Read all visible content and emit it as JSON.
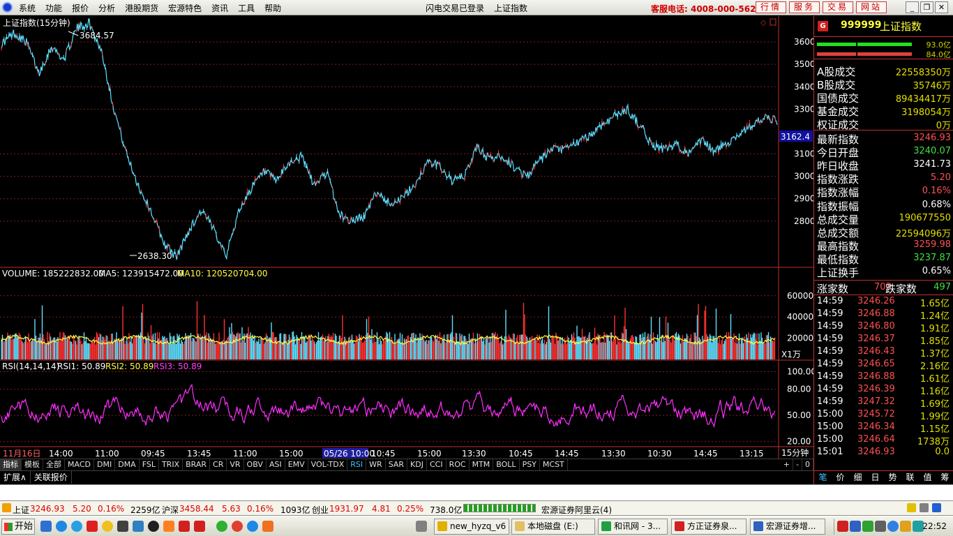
{
  "menubar": {
    "items": [
      "系统",
      "功能",
      "报价",
      "分析",
      "港股期货",
      "宏源特色",
      "资讯",
      "工具",
      "帮助"
    ],
    "status": "闪电交易已登录",
    "current": "上证指数",
    "phone": "客服电话: 4008-000-562",
    "buttons": [
      "行情",
      "服务",
      "交易",
      "网站"
    ]
  },
  "chart": {
    "title": "上证指数(15分钟)",
    "high_label": "3684.57",
    "low_label": "2638.30",
    "cursor_price": "3162.4",
    "price_ticks": [
      "3600",
      "3500",
      "3400",
      "3300",
      "3100",
      "3000",
      "2900",
      "2800"
    ],
    "volume_title": "VOLUME: 185222832.00",
    "ma5": "MA5: 123915472.00",
    "ma10": "MA10: 120520704.00",
    "volume_ticks": [
      "60000",
      "40000",
      "20000"
    ],
    "volume_unit": "X1万",
    "rsi_title": "RSI(14,14,14)",
    "rsi1": "RSI1: 50.89",
    "rsi2": "RSI2: 50.89",
    "rsi3": "RSI3: 50.89",
    "rsi_ticks": [
      "100.00",
      "80.00",
      "50.00",
      "20.00"
    ],
    "time_axis": [
      "11月16日",
      "14:00",
      "11:00",
      "09:45",
      "13:45",
      "11:00",
      "15:00",
      "05/26 10:00",
      "10:45",
      "15:00",
      "13:30",
      "10:45",
      "14:45",
      "13:30",
      "10:30",
      "14:45",
      "13:15"
    ],
    "period": "15分钟"
  },
  "chart_data": [
    {
      "type": "line",
      "title": "上证指数(15分钟)",
      "ylim": [
        2600,
        3700
      ],
      "y_ticks": [
        2800,
        2900,
        3000,
        3100,
        3300,
        3400,
        3500,
        3600
      ],
      "series": [
        {
          "values": [
            3590,
            3640,
            3600,
            3460,
            3580,
            3520,
            3660,
            3684.57,
            3560,
            3300,
            3100,
            2950,
            2840,
            2700,
            2638.3,
            2760,
            2850,
            2760,
            2650,
            2850,
            2950,
            3020,
            2980,
            3060,
            3090,
            2960,
            3020,
            2830,
            2800,
            2820,
            2930,
            2880,
            2900,
            2960,
            3060,
            3050,
            2980,
            3000,
            3130,
            3080,
            3090,
            3040,
            3000,
            3070,
            3120,
            3120,
            3150,
            3180,
            3230,
            3270,
            3300,
            3230,
            3140,
            3120,
            3140,
            3100,
            3160,
            3110,
            3150,
            3190,
            3230,
            3260,
            3246.93
          ]
        }
      ]
    },
    {
      "type": "bar",
      "title": "VOLUME: 185222832.00",
      "ylim": [
        0,
        75000
      ],
      "y_ticks": [
        20000,
        40000,
        60000
      ],
      "unit": "X1万"
    },
    {
      "type": "line",
      "title": "RSI(14,14,14)",
      "ylim": [
        15,
        110
      ],
      "y_ticks": [
        20,
        50,
        80,
        100
      ]
    }
  ],
  "quote": {
    "code": "999999",
    "name": "上证指数",
    "buy_val": "93.0亿",
    "sell_val": "84.0亿",
    "rows1": [
      {
        "k": "A股成交",
        "v": "22558350万",
        "c": "#e0e000"
      },
      {
        "k": "B股成交",
        "v": "35746万",
        "c": "#e0e000"
      },
      {
        "k": "国债成交",
        "v": "89434417万",
        "c": "#e0e000"
      },
      {
        "k": "基金成交",
        "v": "3198054万",
        "c": "#e0e000"
      },
      {
        "k": "权证成交",
        "v": "0万",
        "c": "#e0e000"
      }
    ],
    "rows2": [
      {
        "k": "最新指数",
        "v": "3246.93",
        "c": "#ff5050"
      },
      {
        "k": "今日开盘",
        "v": "3240.07",
        "c": "#40e040"
      },
      {
        "k": "昨日收盘",
        "v": "3241.73",
        "c": "#ffffff"
      },
      {
        "k": "指数涨跌",
        "v": "5.20",
        "c": "#ff5050"
      },
      {
        "k": "指数涨幅",
        "v": "0.16%",
        "c": "#ff5050"
      },
      {
        "k": "指数振幅",
        "v": "0.68%",
        "c": "#ffffff"
      },
      {
        "k": "总成交量",
        "v": "190677550",
        "c": "#e0e000"
      },
      {
        "k": "总成交额",
        "v": "22594096万",
        "c": "#e0e000"
      },
      {
        "k": "最高指数",
        "v": "3259.98",
        "c": "#ff5050"
      },
      {
        "k": "最低指数",
        "v": "3237.87",
        "c": "#40e040"
      },
      {
        "k": "上证换手",
        "v": "0.65%",
        "c": "#ffffff"
      }
    ],
    "rise_label": "涨家数",
    "rise": "703",
    "fall_label": "跌家数",
    "fall": "497",
    "ticks": [
      {
        "t": "14:59",
        "p": "3246.26",
        "v": "1.65亿"
      },
      {
        "t": "14:59",
        "p": "3246.88",
        "v": "1.24亿"
      },
      {
        "t": "14:59",
        "p": "3246.80",
        "v": "1.91亿"
      },
      {
        "t": "14:59",
        "p": "3246.37",
        "v": "1.85亿"
      },
      {
        "t": "14:59",
        "p": "3246.43",
        "v": "1.37亿"
      },
      {
        "t": "14:59",
        "p": "3246.65",
        "v": "2.16亿"
      },
      {
        "t": "14:59",
        "p": "3246.88",
        "v": "1.61亿"
      },
      {
        "t": "14:59",
        "p": "3246.39",
        "v": "1.16亿"
      },
      {
        "t": "14:59",
        "p": "3247.32",
        "v": "1.69亿"
      },
      {
        "t": "15:00",
        "p": "3245.72",
        "v": "1.99亿"
      },
      {
        "t": "15:00",
        "p": "3246.34",
        "v": "1.15亿"
      },
      {
        "t": "15:00",
        "p": "3246.64",
        "v": "1738万"
      },
      {
        "t": "15:01",
        "p": "3246.93",
        "v": "0.0"
      }
    ],
    "tabs": [
      "笔",
      "价",
      "细",
      "日",
      "势",
      "联",
      "值",
      "筹"
    ]
  },
  "indicators": [
    "指标",
    "模板",
    "全部",
    "MACD",
    "DMI",
    "DMA",
    "FSL",
    "TRIX",
    "BRAR",
    "CR",
    "VR",
    "OBV",
    "ASI",
    "EMV",
    "VOL-TDX",
    "RSI",
    "WR",
    "SAR",
    "KDJ",
    "CCI",
    "ROC",
    "MTM",
    "BOLL",
    "PSY",
    "MCST"
  ],
  "ind_right": [
    "+",
    "-",
    "0"
  ],
  "ext": [
    "扩展∧",
    "关联报价"
  ],
  "ticker": {
    "sh_name": "上证",
    "sh_val": "3246.93",
    "sh_chg": "5.20",
    "sh_pct": "0.16%",
    "sh_amt": "2259亿",
    "hs_name": "沪深",
    "hs_val": "3458.44",
    "hs_chg": "5.63",
    "hs_pct": "0.16%",
    "hs_amt": "1093亿",
    "cy_name": "创业",
    "cy_val": "1931.97",
    "cy_chg": "4.81",
    "cy_pct": "0.25%",
    "cy_amt": "738.0亿",
    "server": "宏源证券阿里云(4)"
  },
  "taskbar": {
    "start": "开始",
    "tasks": [
      "new_hyzq_v6",
      "本地磁盘 (E:)",
      "和讯网 - 3...",
      "方正证券泉...",
      "宏源证券增..."
    ],
    "clock": "22:52"
  }
}
